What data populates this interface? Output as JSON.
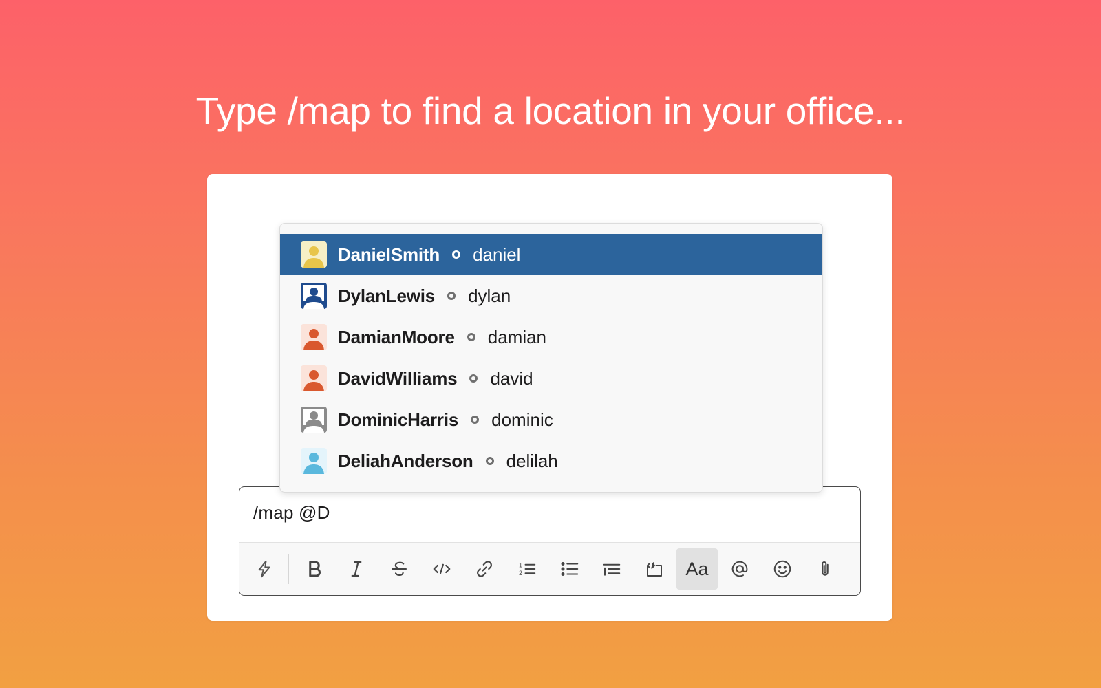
{
  "headline": "Type /map to find a location in your office...",
  "mention_dropdown": {
    "users": [
      {
        "display_name": "DanielSmith",
        "username": "daniel",
        "selected": true,
        "avatar": {
          "bg": "#f6efc6",
          "figure": "#e8c54a",
          "style": "square-light"
        }
      },
      {
        "display_name": "DylanLewis",
        "username": "dylan",
        "selected": false,
        "avatar": {
          "bg": "#1f4b8e",
          "figure": "#ffffff",
          "style": "framed"
        }
      },
      {
        "display_name": "DamianMoore",
        "username": "damian",
        "selected": false,
        "avatar": {
          "bg": "#fbe3da",
          "figure": "#d9582e",
          "style": "square-light"
        }
      },
      {
        "display_name": "DavidWilliams",
        "username": "david",
        "selected": false,
        "avatar": {
          "bg": "#fbe3da",
          "figure": "#d9582e",
          "style": "square-light"
        }
      },
      {
        "display_name": "DominicHarris",
        "username": "dominic",
        "selected": false,
        "avatar": {
          "bg": "#8b8b8b",
          "figure": "#ffffff",
          "style": "framed"
        }
      },
      {
        "display_name": "DeliahAnderson",
        "username": "delilah",
        "selected": false,
        "avatar": {
          "bg": "#e4f4fb",
          "figure": "#5ab8dd",
          "style": "square-light"
        }
      }
    ]
  },
  "composer": {
    "value": "/map @D"
  },
  "toolbar": {
    "tools": [
      "lightning-icon",
      "bold-icon",
      "italic-icon",
      "strikethrough-icon",
      "code-icon",
      "link-icon",
      "ordered-list-icon",
      "bulleted-list-icon",
      "blockquote-icon",
      "code-block-icon",
      "formatting-toggle",
      "mention-icon",
      "emoji-icon",
      "attachment-icon"
    ],
    "formatting_label": "Aa",
    "active_tool": "formatting-toggle"
  },
  "colors": {
    "selected_row": "#2c649c",
    "gradient_top": "#fd6169",
    "gradient_bottom": "#f2a042"
  }
}
